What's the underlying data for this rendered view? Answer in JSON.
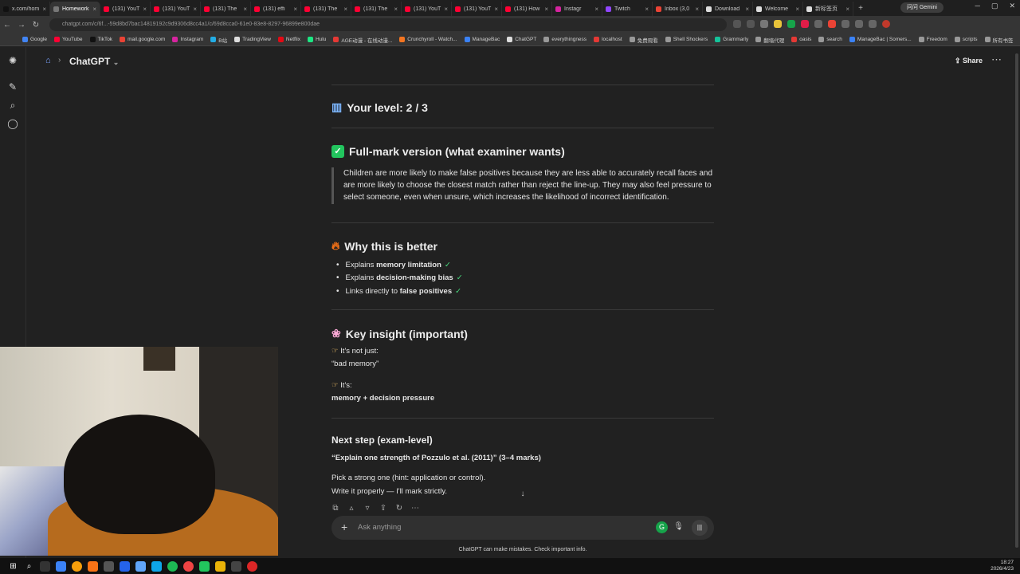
{
  "browser": {
    "tabs": [
      {
        "label": "x.com/hom",
        "color": "#111111"
      },
      {
        "label": "Homework",
        "color": "#777777"
      },
      {
        "label": "(131) YouT",
        "color": "#ff0033"
      },
      {
        "label": "(131) YouT",
        "color": "#ff0033"
      },
      {
        "label": "(131) The",
        "color": "#ff0033"
      },
      {
        "label": "(131) effi",
        "color": "#ff0033"
      },
      {
        "label": "(131) The",
        "color": "#ff0033"
      },
      {
        "label": "(131) The",
        "color": "#ff0033"
      },
      {
        "label": "(131) YouT",
        "color": "#ff0033"
      },
      {
        "label": "(131) YouT",
        "color": "#ff0033"
      },
      {
        "label": "(131) How",
        "color": "#ff0033"
      },
      {
        "label": "Instagr",
        "color": "#d6249f"
      },
      {
        "label": "Twitch",
        "color": "#9146ff"
      },
      {
        "label": "Inbox (3,0",
        "color": "#ea4335"
      },
      {
        "label": "Download",
        "color": "#dddddd"
      },
      {
        "label": "Welcome",
        "color": "#dddddd"
      },
      {
        "label": "新标签页",
        "color": "#dddddd"
      }
    ],
    "profile": "问问 Gemini",
    "url": "chatgpt.com/c/6f...-59d8bd7bac14819192c9d9306d8cc4a1/c/69d8cca0-61e0-83e8-8297-96899e800dae",
    "bookmarks": [
      {
        "label": "Google",
        "color": "#4285f4"
      },
      {
        "label": "YouTube",
        "color": "#ff0033"
      },
      {
        "label": "TikTok",
        "color": "#111111"
      },
      {
        "label": "mail.google.com",
        "color": "#ea4335"
      },
      {
        "label": "Instagram",
        "color": "#d6249f"
      },
      {
        "label": "B站",
        "color": "#23ade5"
      },
      {
        "label": "TradingView",
        "color": "#dddddd"
      },
      {
        "label": "Netflix",
        "color": "#e50914"
      },
      {
        "label": "Hulu",
        "color": "#1ce783"
      },
      {
        "label": "AGE动漫 - 在线动漫...",
        "color": "#e53935"
      },
      {
        "label": "Crunchyroll - Watch...",
        "color": "#f47521"
      },
      {
        "label": "ManageBac",
        "color": "#3b82f6"
      },
      {
        "label": "ChatGPT",
        "color": "#dddddd"
      },
      {
        "label": "everythingness",
        "color": "#999999"
      },
      {
        "label": "localhost",
        "color": "#e53935"
      },
      {
        "label": "免费观看",
        "color": "#999999"
      },
      {
        "label": "Shell Shockers",
        "color": "#999999"
      },
      {
        "label": "Grammarly",
        "color": "#15c39a"
      },
      {
        "label": "翻墙代理",
        "color": "#999999"
      },
      {
        "label": "oasis",
        "color": "#e53935"
      },
      {
        "label": "search",
        "color": "#999999"
      },
      {
        "label": "ManageBac | Somers...",
        "color": "#3b82f6"
      },
      {
        "label": "Freedom",
        "color": "#999999"
      },
      {
        "label": "scripts",
        "color": "#999999"
      },
      {
        "label": "所有书签",
        "color": "#999999"
      }
    ]
  },
  "app": {
    "title": "ChatGPT",
    "share_label": "Share"
  },
  "message": {
    "level": "Your level: 2 / 3",
    "fullmark_heading": "Full-mark version (what examiner wants)",
    "fullmark_quote": "Children are more likely to make false positives because they are less able to accurately recall faces and are more likely to choose the closest match rather than reject the line-up. They may also feel pressure to select someone, even when unsure, which increases the likelihood of incorrect identification.",
    "why_heading": "Why this is better",
    "why_items": [
      {
        "prefix": "Explains ",
        "bold": "memory limitation"
      },
      {
        "prefix": "Explains ",
        "bold": "decision-making bias"
      },
      {
        "prefix": "Links directly to ",
        "bold": "false positives"
      }
    ],
    "insight_heading": "Key insight (important)",
    "insight_not_label": "It's not just:",
    "insight_not_value": "“bad memory”",
    "insight_is_label": "It's:",
    "insight_is_value": "memory + decision pressure",
    "next_heading": "Next step (exam-level)",
    "next_question": "“Explain one strength of Pozzulo et al. (2011)” (3–4 marks)",
    "next_line1": "Pick a strong one (hint: application or control).",
    "next_line2": "Write it properly — I'll mark strictly."
  },
  "composer": {
    "placeholder": "Ask anything",
    "disclaimer": "ChatGPT can make mistakes. Check important info."
  },
  "taskbar": {
    "time": "18:27",
    "date": "2026/4/23"
  }
}
